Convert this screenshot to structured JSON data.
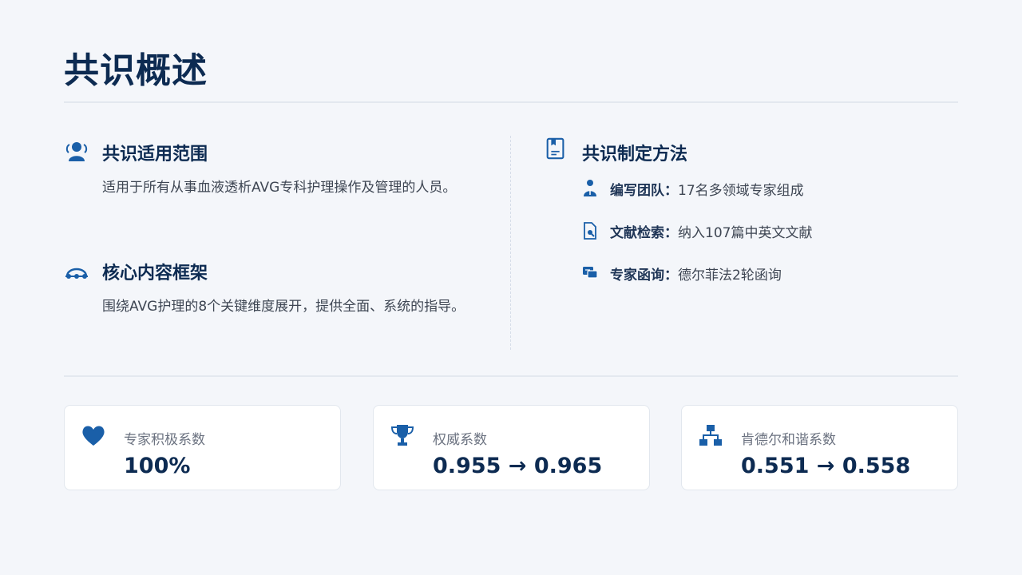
{
  "title": "共识概述",
  "scope": {
    "heading": "共识适用范围",
    "text": "适用于所有从事血液透析AVG专科护理操作及管理的人员。",
    "icon": "user-group-icon"
  },
  "framework": {
    "heading": "核心内容框架",
    "text": "围绕AVG护理的8个关键维度展开，提供全面、系统的指导。",
    "icon": "network-icon"
  },
  "method": {
    "heading": "共识制定方法",
    "icon": "book-icon",
    "items": [
      {
        "label": "编写团队：",
        "value": "17名多领域专家组成",
        "icon": "doctor-icon"
      },
      {
        "label": "文献检索：",
        "value": "纳入107篇中英文文献",
        "icon": "file-search-icon"
      },
      {
        "label": "专家函询：",
        "value": "德尔菲法2轮函询",
        "icon": "comments-icon"
      }
    ]
  },
  "stats": [
    {
      "label": "专家积极系数",
      "value": "100%",
      "icon": "heart-icon"
    },
    {
      "label": "权威系数",
      "value": "0.955 → 0.965",
      "icon": "trophy-icon"
    },
    {
      "label": "肯德尔和谐系数",
      "value": "0.551 → 0.558",
      "icon": "hierarchy-icon"
    }
  ],
  "colors": {
    "accent": "#1a5fa8",
    "title": "#0d2b52",
    "background": "#f4f6fa"
  }
}
